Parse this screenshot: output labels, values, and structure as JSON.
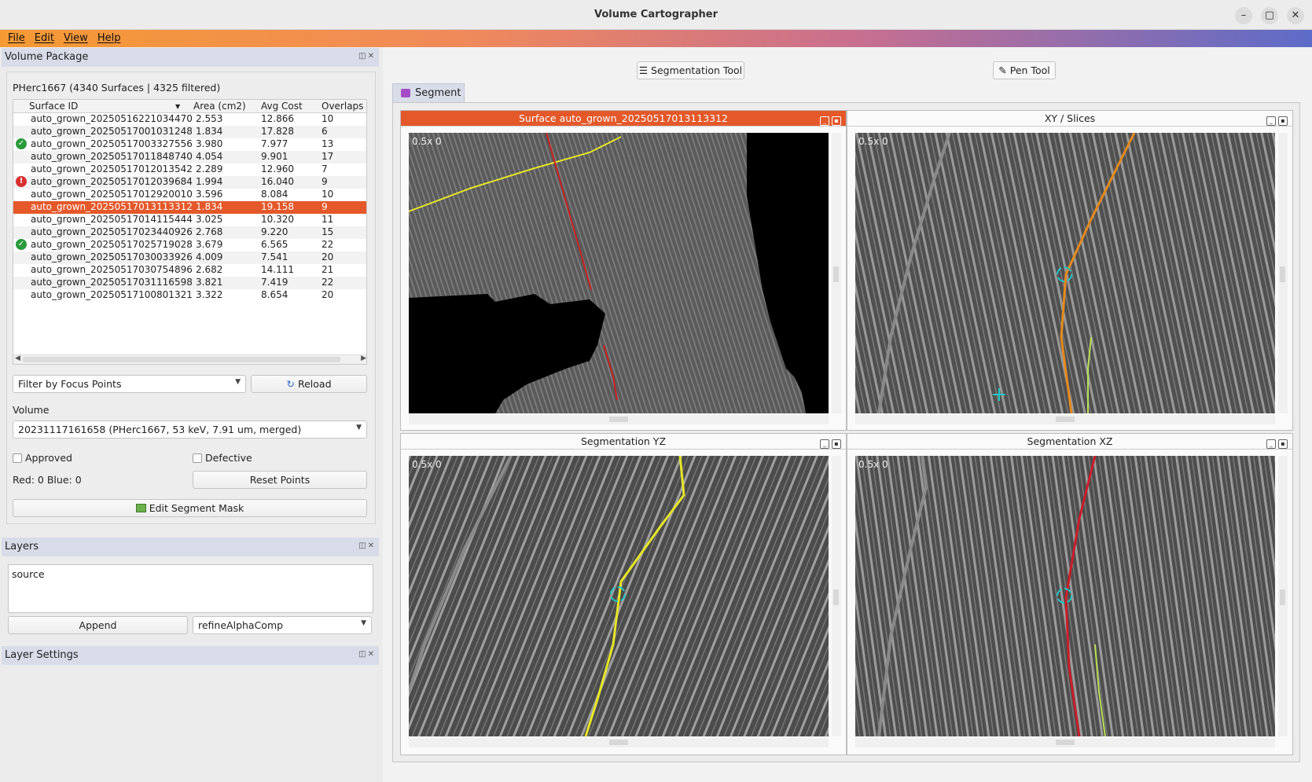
{
  "window": {
    "title": "Volume Cartographer",
    "controls": [
      "–",
      "▢",
      "✕"
    ]
  },
  "menu": [
    "File",
    "Edit",
    "View",
    "Help"
  ],
  "volume_package": {
    "title": "Volume Package",
    "package_label": "PHerc1667 (4340 Surfaces | 4325 filtered)",
    "columns": [
      "Surface ID",
      "Area (cm2)",
      "Avg Cost",
      "Overlaps"
    ],
    "rows": [
      {
        "id": "auto_grown_20250516221034470",
        "area": "2.553",
        "cost": "12.866",
        "overlaps": "10",
        "status": ""
      },
      {
        "id": "auto_grown_20250517001031248",
        "area": "1.834",
        "cost": "17.828",
        "overlaps": "6",
        "status": ""
      },
      {
        "id": "auto_grown_20250517003327556",
        "area": "3.980",
        "cost": "7.977",
        "overlaps": "13",
        "status": "approved"
      },
      {
        "id": "auto_grown_20250517011848740",
        "area": "4.054",
        "cost": "9.901",
        "overlaps": "17",
        "status": ""
      },
      {
        "id": "auto_grown_20250517012013542",
        "area": "2.289",
        "cost": "12.960",
        "overlaps": "7",
        "status": ""
      },
      {
        "id": "auto_grown_20250517012039684",
        "area": "1.994",
        "cost": "16.040",
        "overlaps": "9",
        "status": "defective"
      },
      {
        "id": "auto_grown_20250517012920010",
        "area": "3.596",
        "cost": "8.084",
        "overlaps": "10",
        "status": ""
      },
      {
        "id": "auto_grown_20250517013113312",
        "area": "1.834",
        "cost": "19.158",
        "overlaps": "9",
        "status": "selected"
      },
      {
        "id": "auto_grown_20250517014115444",
        "area": "3.025",
        "cost": "10.320",
        "overlaps": "11",
        "status": ""
      },
      {
        "id": "auto_grown_20250517023440926",
        "area": "2.768",
        "cost": "9.220",
        "overlaps": "15",
        "status": ""
      },
      {
        "id": "auto_grown_20250517025719028",
        "area": "3.679",
        "cost": "6.565",
        "overlaps": "22",
        "status": "approved"
      },
      {
        "id": "auto_grown_20250517030033926",
        "area": "4.009",
        "cost": "7.541",
        "overlaps": "20",
        "status": ""
      },
      {
        "id": "auto_grown_20250517030754896",
        "area": "2.682",
        "cost": "14.111",
        "overlaps": "21",
        "status": ""
      },
      {
        "id": "auto_grown_20250517031116598",
        "area": "3.821",
        "cost": "7.419",
        "overlaps": "22",
        "status": ""
      },
      {
        "id": "auto_grown_20250517100801321",
        "area": "3.322",
        "cost": "8.654",
        "overlaps": "20",
        "status": ""
      }
    ],
    "filter_value": "Filter by Focus Points",
    "reload_label": "Reload",
    "volume_label": "Volume",
    "volume_value": "20231117161658 (PHerc1667, 53 keV, 7.91 um, merged)",
    "approved_label": "Approved",
    "defective_label": "Defective",
    "points_text": "Red: 0 Blue: 0",
    "reset_points_label": "Reset Points",
    "edit_mask_label": "Edit Segment Mask"
  },
  "layers": {
    "title": "Layers",
    "items": [
      "source"
    ],
    "append_label": "Append",
    "filter_value": "refineAlphaComp"
  },
  "layer_settings": {
    "title": "Layer Settings"
  },
  "toolbar": {
    "segmentation_tool_label": "Segmentation Tool",
    "pen_tool_label": "Pen Tool"
  },
  "tab": {
    "label": "Segment"
  },
  "viewers": {
    "surface": {
      "title": "Surface auto_grown_20250517013113312",
      "zoom": "0.5x 0"
    },
    "xy": {
      "title": "XY / Slices",
      "zoom": "0.5x 0"
    },
    "yz": {
      "title": "Segmentation YZ",
      "zoom": "0.5x 0"
    },
    "xz": {
      "title": "Segmentation XZ",
      "zoom": "0.5x 0"
    }
  },
  "colors": {
    "selection": "#e4582a",
    "approved": "#2a9a3a",
    "defective": "#d93030",
    "menubar_start": "#f59a33",
    "menubar_end": "#5d6cc8"
  }
}
